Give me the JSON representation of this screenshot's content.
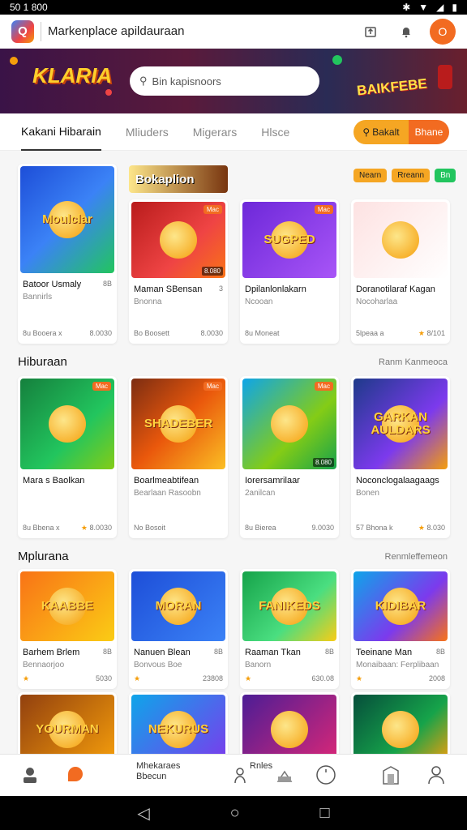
{
  "status_bar": {
    "time": "50 1 800",
    "icons": [
      "whatsapp-icon",
      "youtube-icon",
      "bluetooth-icon",
      "wifi-icon",
      "signal-icon",
      "battery-icon"
    ]
  },
  "app_bar": {
    "title": "Markenplace apildauraan",
    "logo_letter": "Q"
  },
  "banner": {
    "left_logo": "KLARIA",
    "right_logo": "BAIKFEBE",
    "search_placeholder": "Bin kapisnoors"
  },
  "tabs": [
    {
      "label": "Kakani Hibarain",
      "active": true
    },
    {
      "label": "Mliuders",
      "active": false
    },
    {
      "label": "Migerars",
      "active": false
    },
    {
      "label": "Hlsce",
      "active": false
    }
  ],
  "pill_button": {
    "primary": "Bakalt",
    "secondary": "Bhane"
  },
  "filter_chips": [
    {
      "label": "Nearn",
      "color": "#f5a623"
    },
    {
      "label": "Rreann",
      "color": "#f5a623"
    },
    {
      "label": "Bn",
      "color": "#22c55e"
    }
  ],
  "feature_header": "Bokaplion",
  "row1": [
    {
      "title": "Moulclar",
      "name": "Batoor Usmaly",
      "name_num": "8B",
      "sub": "Bannirls",
      "foot_left": "8u Booera x",
      "foot_right": "8.0030",
      "star": false,
      "badge": "",
      "corner": "",
      "bg": "linear-gradient(135deg,#1d4ed8,#3b82f6 50%,#22c55e)"
    },
    {
      "title": "",
      "name": "Maman SBensan",
      "name_num": "3",
      "sub": "Bnonna",
      "foot_left": "Bo Boosett",
      "foot_right": "8.0030",
      "star": false,
      "badge": "Mac",
      "corner": "8.080",
      "bg": "linear-gradient(135deg,#b91c1c,#ef4444 60%,#f97316)"
    },
    {
      "title": "SUGPED",
      "name": "Dpilanlonlakarn",
      "name_num": "",
      "sub": "Ncooan",
      "foot_left": "8u Moneat",
      "foot_right": "",
      "star": false,
      "badge": "Mac",
      "corner": "",
      "bg": "linear-gradient(135deg,#6d28d9,#a855f7)"
    },
    {
      "title": "",
      "name": "Doranotilaraf Kagan",
      "name_num": "",
      "sub": "Nocoharlaa",
      "foot_left": "5lpeaa a",
      "foot_right": "8/101",
      "star": true,
      "badge": "",
      "corner": "",
      "bg": "linear-gradient(135deg,#fde2e2,#fff)"
    }
  ],
  "section2": {
    "title": "Hiburaan",
    "more": "Ranm Kanmeoca"
  },
  "row2": [
    {
      "title": "",
      "name": "Mara s Baolkan",
      "name_num": "",
      "sub": "",
      "foot_left": "8u Bbena x",
      "foot_right": "8.0030",
      "star": true,
      "badge": "Mac",
      "corner": "",
      "bg": "linear-gradient(135deg,#15803d,#22c55e 60%,#84cc16)"
    },
    {
      "title": "SHADEBER",
      "name": "Boarlmeabtifean",
      "name_num": "",
      "sub": "Bearlaan Rasoobn",
      "foot_left": "No Bosoit",
      "foot_right": "",
      "star": false,
      "badge": "Mac",
      "corner": "",
      "bg": "linear-gradient(135deg,#7c2d12,#ea580c 50%,#fbbf24)"
    },
    {
      "title": "",
      "name": "Iorersamrilaar",
      "name_num": "",
      "sub": "2anilcan",
      "foot_left": "8u Bierea",
      "foot_right": "9.0030",
      "star": false,
      "badge": "Mac",
      "corner": "8.080",
      "bg": "linear-gradient(135deg,#0ea5e9,#84cc16 60%,#16a34a)"
    },
    {
      "title": "GARKAN AULDARS",
      "name": "Noconclogalaagaags",
      "name_num": "",
      "sub": "Bonen",
      "foot_left": "57 Bhona k",
      "foot_right": "8.030",
      "star": true,
      "badge": "",
      "corner": "",
      "bg": "linear-gradient(135deg,#1e3a8a,#7c3aed 60%,#f59e0b)"
    }
  ],
  "section3": {
    "title": "Mplurana",
    "more": "Renmleffemeon"
  },
  "row3": [
    {
      "title": "KAABBE",
      "name": "Barhem Brlem",
      "name_num": "8B",
      "sub": "Bennaorjoo",
      "foot_left": "5030",
      "foot_right": "",
      "star": true,
      "badge": "",
      "corner": "",
      "bg": "linear-gradient(135deg,#f97316,#facc15)"
    },
    {
      "title": "MORAN",
      "name": "Nanuen Blean",
      "name_num": "8B",
      "sub": "Bonvous Boe",
      "foot_left": "23808",
      "foot_right": "",
      "star": true,
      "badge": "",
      "corner": "",
      "bg": "linear-gradient(135deg,#1d4ed8,#3b82f6)"
    },
    {
      "title": "FANIKEDS",
      "name": "Raaman Tkan",
      "name_num": "8B",
      "sub": "Banorn",
      "foot_left": "630.08",
      "foot_right": "",
      "star": true,
      "badge": "",
      "corner": "",
      "bg": "linear-gradient(135deg,#16a34a,#4ade80 60%,#facc15)"
    },
    {
      "title": "KIDIBAR",
      "name": "Teeinane Man",
      "name_num": "8B",
      "sub": "Monaibaan: Ferplibaan",
      "foot_left": "2008",
      "foot_right": "",
      "star": true,
      "badge": "",
      "corner": "",
      "bg": "linear-gradient(135deg,#0ea5e9,#7c3aed 60%,#f97316)"
    }
  ],
  "row4": [
    {
      "title": "YOURMAN",
      "bg": "linear-gradient(135deg,#92400e,#f59e0b)"
    },
    {
      "title": "NEKURUS",
      "bg": "linear-gradient(135deg,#0ea5e9,#7c3aed)"
    },
    {
      "title": "",
      "bg": "linear-gradient(135deg,#4c1d95,#db2777)"
    },
    {
      "title": "",
      "bg": "linear-gradient(135deg,#064e3b,#16a34a 60%,#f59e0b)"
    }
  ],
  "bottom_nav": {
    "text_block_1_line1": "Mhekaraes",
    "text_block_1_line2": "Bbecun",
    "text_block_2": "Rnles"
  }
}
